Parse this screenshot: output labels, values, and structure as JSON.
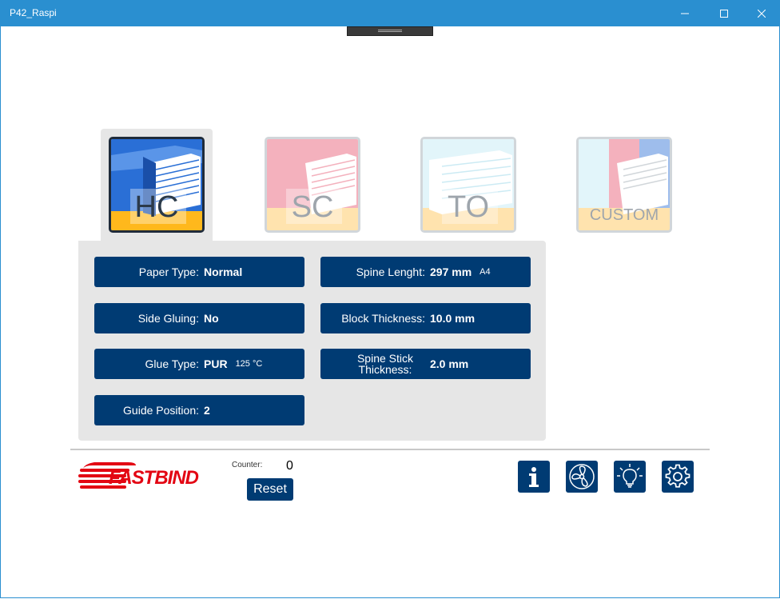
{
  "window": {
    "title": "P42_Raspi"
  },
  "modes": [
    {
      "label": "HC",
      "active": true
    },
    {
      "label": "SC",
      "active": false
    },
    {
      "label": "TO",
      "active": false
    },
    {
      "label": "CUSTOM",
      "active": false
    }
  ],
  "settings": {
    "paper_type": {
      "label": "Paper Type:",
      "value": "Normal"
    },
    "side_gluing": {
      "label": "Side Gluing:",
      "value": "No"
    },
    "glue_type": {
      "label": "Glue Type:",
      "value": "PUR",
      "extra": "125 °C"
    },
    "guide_position": {
      "label": "Guide Position:",
      "value": "2"
    },
    "spine_length": {
      "label": "Spine Lenght:",
      "value": "297 mm",
      "extra": "A4"
    },
    "block_thickness": {
      "label": "Block Thickness:",
      "value": "10.0 mm"
    },
    "spine_stick_thickness": {
      "label": "Spine Stick Thickness:",
      "value": "2.0 mm"
    }
  },
  "footer": {
    "brand": "FASTBIND",
    "counter_label": "Counter:",
    "counter_value": "0",
    "reset_label": "Reset",
    "icons": [
      "info-icon",
      "fan-icon",
      "light-bulb-icon",
      "settings-gear-icon"
    ]
  },
  "colors": {
    "titlebar": "#2a8fd0",
    "button": "#003b73",
    "panel": "#e6e6e6",
    "hc_blue": "#1f5fbf",
    "hc_yellow": "#ffb81c",
    "sc_pink": "#e8556f",
    "to_cyan": "#8fd3e8",
    "brand_red": "#e30613"
  }
}
